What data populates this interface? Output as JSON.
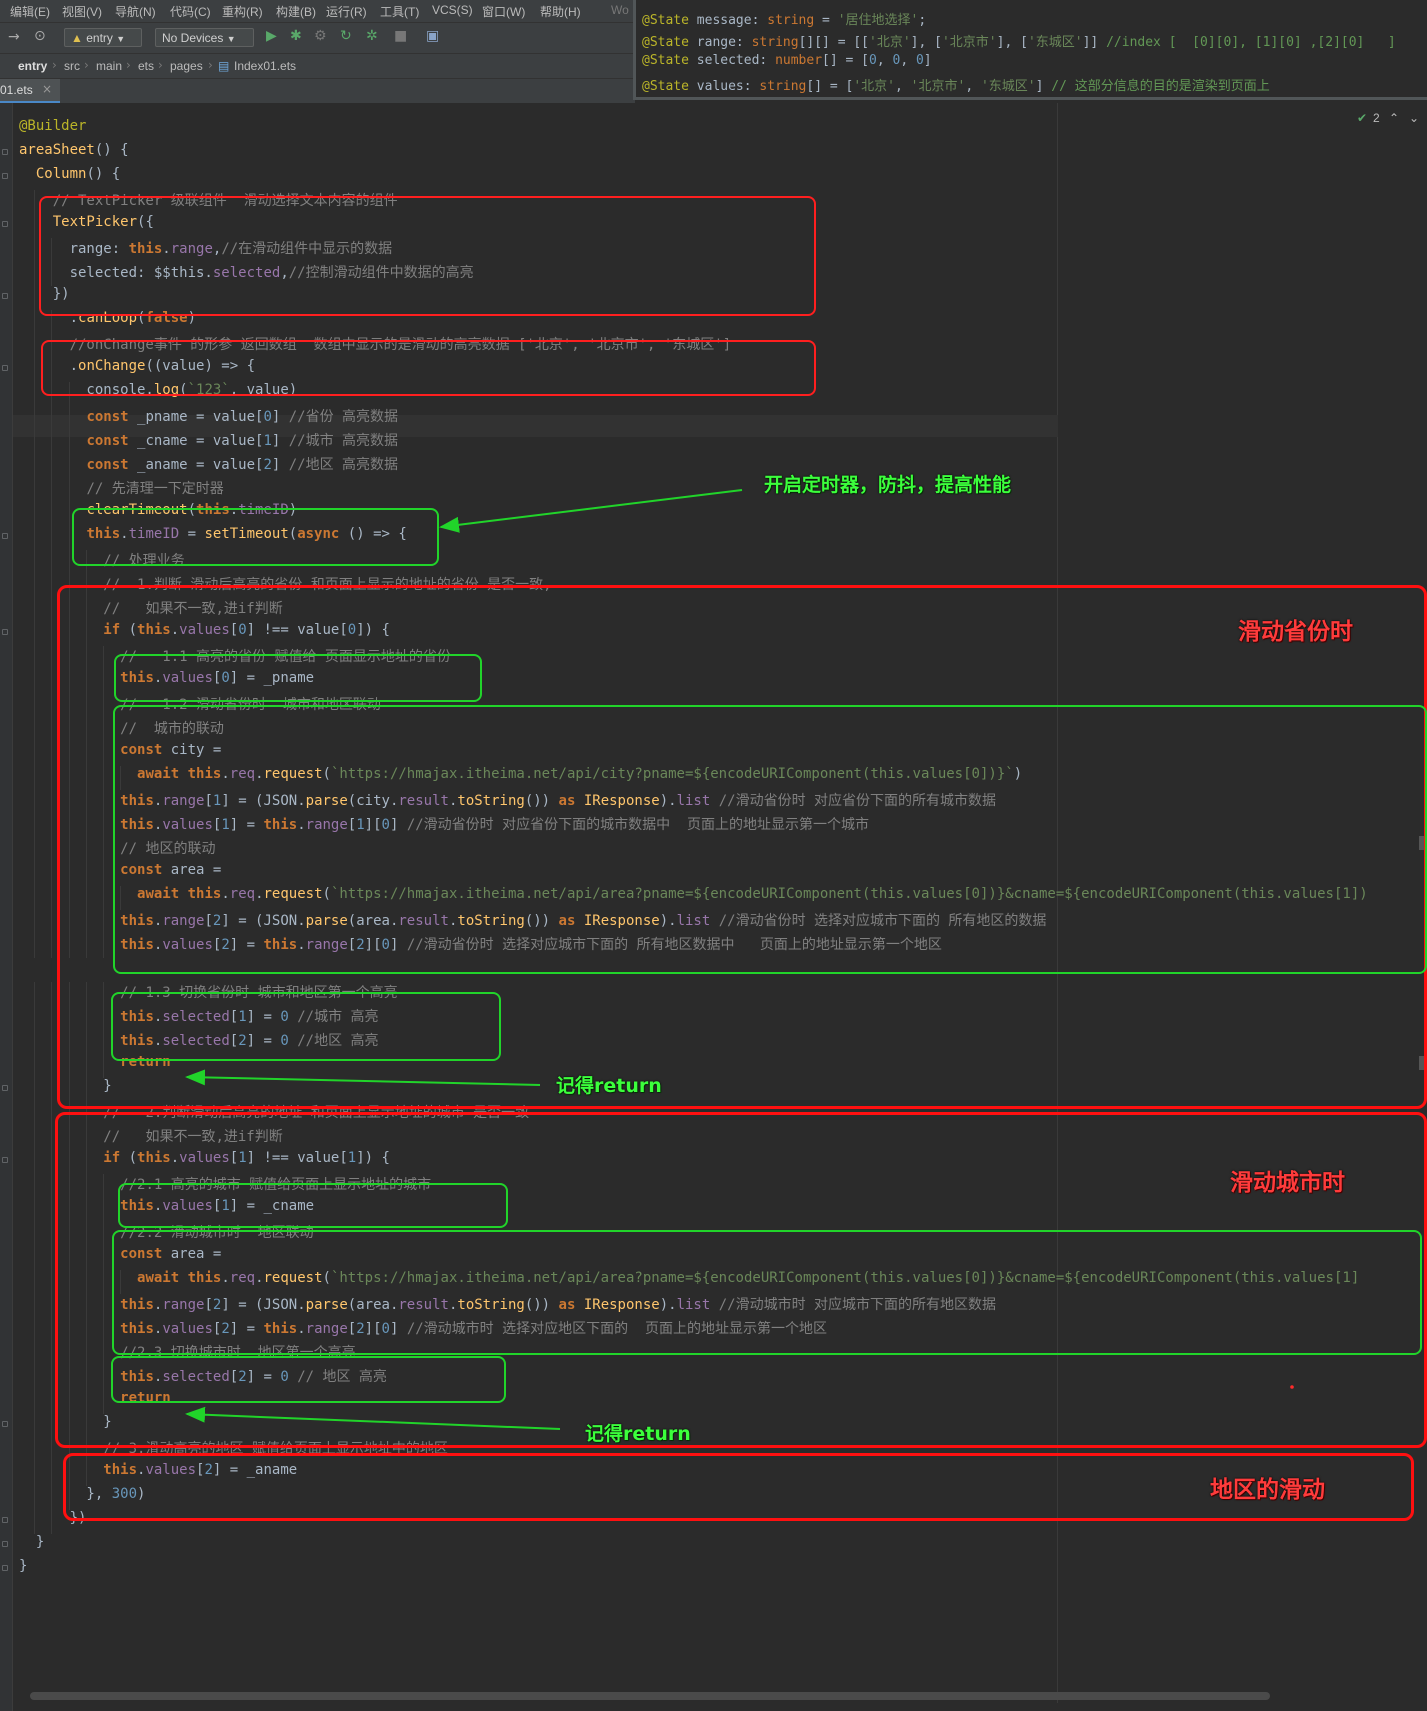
{
  "menubar": {
    "items": [
      "编辑(E)",
      "视图(V)",
      "导航(N)",
      "代码(C)",
      "重构(R)",
      "构建(B)",
      "运行(R)",
      "工具(T)",
      "VCS(S)",
      "窗口(W)",
      "帮助(H)",
      "Wo"
    ]
  },
  "toolbar": {
    "config_label": "entry",
    "device_label": "No Devices"
  },
  "breadcrumb": {
    "items": [
      "entry",
      "src",
      "main",
      "ets",
      "pages",
      "Index01.ets"
    ]
  },
  "tabs": [
    {
      "label": "01.ets",
      "close": "×"
    }
  ],
  "inspection": {
    "count": "2"
  },
  "state_panel": {
    "lines": [
      "@State message: string = '居住地选择';",
      "@State range: string[][] = [['北京'], ['北京市'], ['东城区']] //index [  [0][0], [1][0] ,[2][0]   ]",
      "@State selected: number[] = [0, 0, 0]",
      "@State values: string[] = ['北京', '北京市', '东城区'] // 这部分信息的目的是渲染到页面上"
    ]
  },
  "code": {
    "lines": [
      "@Builder",
      "areaSheet() {",
      "  Column() {",
      "    // TextPicker 级联组件  滑动选择文本内容的组件",
      "    TextPicker({",
      "      range: this.range,//在滑动组件中显示的数据",
      "      selected: $$this.selected,//控制滑动组件中数据的高亮",
      "    })",
      "      .canLoop(false)",
      "      //onChange事件 的形参 返回数组  数组中显示的是滑动的高亮数据 ['北京', '北京市', '东城区']",
      "      .onChange((value) => {",
      "        console.log(`123`, value)",
      "        const _pname = value[0] //省份 高亮数据",
      "        const _cname = value[1] //城市 高亮数据",
      "        const _aname = value[2] //地区 高亮数据",
      "        // 先清理一下定时器",
      "        clearTimeout(this.timeID)",
      "        this.timeID = setTimeout(async () => {",
      "          // 处理业务",
      "          //  1.判断 滑动后高亮的省份 和页面上显示的地址的省份 是否一致,",
      "          //   如果不一致,进if判断",
      "          if (this.values[0] !== value[0]) {",
      "            //   1.1 高亮的省份 赋值给 页面显示地址的省份",
      "            this.values[0] = _pname",
      "            //   1.2 滑动省份时  城市和地区联动",
      "            //  城市的联动",
      "            const city =",
      "              await this.req.request(`https://hmajax.itheima.net/api/city?pname=${encodeURIComponent(this.values[0])}`)",
      "            this.range[1] = (JSON.parse(city.result.toString()) as IResponse).list //滑动省份时 对应省份下面的所有城市数据",
      "            this.values[1] = this.range[1][0] //滑动省份时 对应省份下面的城市数据中  页面上的地址显示第一个城市",
      "            // 地区的联动",
      "            const area =",
      "              await this.req.request(`https://hmajax.itheima.net/api/area?pname=${encodeURIComponent(this.values[0])}&cname=${encodeURIComponent(this.values[1])",
      "            this.range[2] = (JSON.parse(area.result.toString()) as IResponse).list //滑动省份时 选择对应城市下面的 所有地区的数据",
      "            this.values[2] = this.range[2][0] //滑动省份时 选择对应城市下面的 所有地区数据中   页面上的地址显示第一个地区",
      "",
      "            // 1.3 切换省份时 城市和地区第一个高亮",
      "            this.selected[1] = 0 //城市 高亮",
      "            this.selected[2] = 0 //地区 高亮",
      "            return",
      "          }",
      "          //   2.判断滑动后高亮的地址 和页面上显示地址的城市 是否一致",
      "          //   如果不一致,进if判断",
      "          if (this.values[1] !== value[1]) {",
      "            //2.1 高亮的城市 赋值给页面上显示地址的城市",
      "            this.values[1] = _cname",
      "            //2.2 滑动城市时  地区联动",
      "            const area =",
      "              await this.req.request(`https://hmajax.itheima.net/api/area?pname=${encodeURIComponent(this.values[0])}&cname=${encodeURIComponent(this.values[1]",
      "            this.range[2] = (JSON.parse(area.result.toString()) as IResponse).list //滑动城市时 对应城市下面的所有地区数据",
      "            this.values[2] = this.range[2][0] //滑动城市时 选择对应地区下面的  页面上的地址显示第一个地区",
      "            //2.3 切换城市时  地区第一个高亮",
      "            this.selected[2] = 0 // 地区 高亮",
      "            return",
      "          }",
      "          // 3.滑动高亮的地区 赋值给页面上显示地址中的地区",
      "          this.values[2] = _aname",
      "        }, 300)",
      "      })",
      "  }",
      "}"
    ]
  },
  "annotations": {
    "debounce": "开启定时器，防抖，提高性能",
    "return1": "记得return",
    "return2": "记得return",
    "province": "滑动省份时",
    "city": "滑动城市时",
    "district": "地区的滑动"
  },
  "colors": {
    "red_box": "#ff1f1f",
    "green_box": "#21d42a",
    "editor_bg": "#2b2b2b"
  }
}
